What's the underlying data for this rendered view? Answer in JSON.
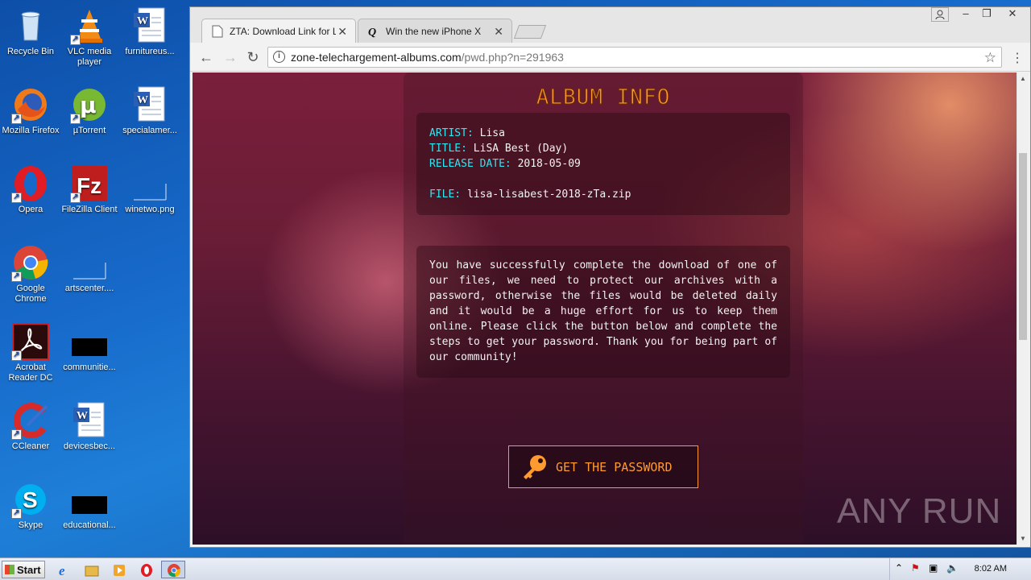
{
  "desktop": {
    "icons": [
      {
        "label": "Recycle Bin",
        "icon": "recycle-bin-icon"
      },
      {
        "label": "VLC media player",
        "icon": "vlc-icon"
      },
      {
        "label": "furnitureus...",
        "icon": "word-doc-icon"
      },
      {
        "label": "Mozilla Firefox",
        "icon": "firefox-icon"
      },
      {
        "label": "µTorrent",
        "icon": "utorrent-icon"
      },
      {
        "label": "specialamer...",
        "icon": "word-doc-icon"
      },
      {
        "label": "Opera",
        "icon": "opera-icon"
      },
      {
        "label": "FileZilla Client",
        "icon": "filezilla-icon"
      },
      {
        "label": "winetwo.png",
        "icon": "image-file-icon"
      },
      {
        "label": "Google Chrome",
        "icon": "chrome-icon"
      },
      {
        "label": "artscenter....",
        "icon": "file-icon"
      },
      {
        "label": "Acrobat Reader DC",
        "icon": "acrobat-icon"
      },
      {
        "label": "communitie...",
        "icon": "file-icon"
      },
      {
        "label": "CCleaner",
        "icon": "ccleaner-icon"
      },
      {
        "label": "devicesbec...",
        "icon": "word-doc-icon"
      },
      {
        "label": "Skype",
        "icon": "skype-icon"
      },
      {
        "label": "educational...",
        "icon": "file-icon"
      }
    ]
  },
  "browser": {
    "tabs": [
      {
        "title": "ZTA: Download Link for Lisa",
        "active": true
      },
      {
        "title": "Win the new iPhone X",
        "active": false
      }
    ],
    "url_host": "zone-telechargement-albums.com",
    "url_path": "/pwd.php?n=291963"
  },
  "page": {
    "heading": "ALBUM INFO",
    "artist_key": "ARTIST:",
    "artist": "Lisa",
    "title_key": "TITLE:",
    "title": "LiSA Best (Day)",
    "release_key": "RELEASE DATE:",
    "release": "2018-05-09",
    "file_key": "FILE:",
    "file": "lisa-lisabest-2018-zTa.zip",
    "message": "You have successfully complete the download of one of our files, we need to protect our archives with a password, otherwise the files would be deleted daily and it would be a huge effort for us to keep them online. Please click the button below and complete the steps to get your password. Thank you for being part of our community!",
    "button": "GET THE PASSWORD",
    "watermark": "ANY RUN"
  },
  "taskbar": {
    "start": "Start",
    "clock": "8:02 AM"
  },
  "colors": {
    "accent_orange": "#ff9a2e",
    "key_cyan": "#2ee6f0"
  }
}
